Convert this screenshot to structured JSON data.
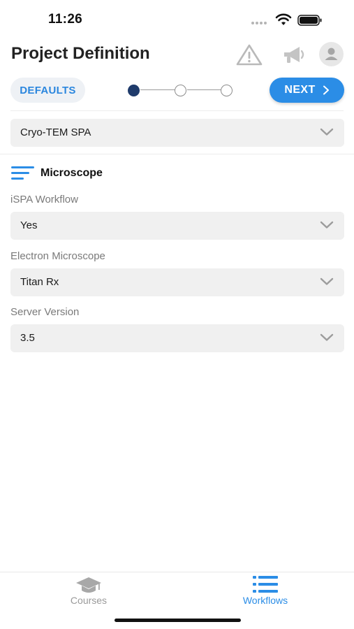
{
  "status_bar": {
    "time": "11:26"
  },
  "header": {
    "title": "Project Definition",
    "icons": [
      "warning-icon",
      "megaphone-icon",
      "avatar-icon"
    ]
  },
  "toolbar": {
    "defaults_label": "DEFAULTS",
    "next_label": "NEXT",
    "steps_total": 3,
    "current_step": 1
  },
  "project_type": {
    "value": "Cryo-TEM SPA"
  },
  "section": {
    "title": "Microscope",
    "icon": "list-lines-icon"
  },
  "fields": [
    {
      "label": "iSPA Workflow",
      "value": "Yes"
    },
    {
      "label": "Electron Microscope",
      "value": "Titan Rx"
    },
    {
      "label": "Server Version",
      "value": "3.5"
    }
  ],
  "tabbar": {
    "tabs": [
      {
        "label": "Courses",
        "icon": "graduation-cap-icon",
        "active": false
      },
      {
        "label": "Workflows",
        "icon": "list-icon",
        "active": true
      }
    ]
  },
  "colors": {
    "accent": "#2b8de6",
    "active_step": "#1f3b6b",
    "field_bg": "#f0f0f0"
  }
}
